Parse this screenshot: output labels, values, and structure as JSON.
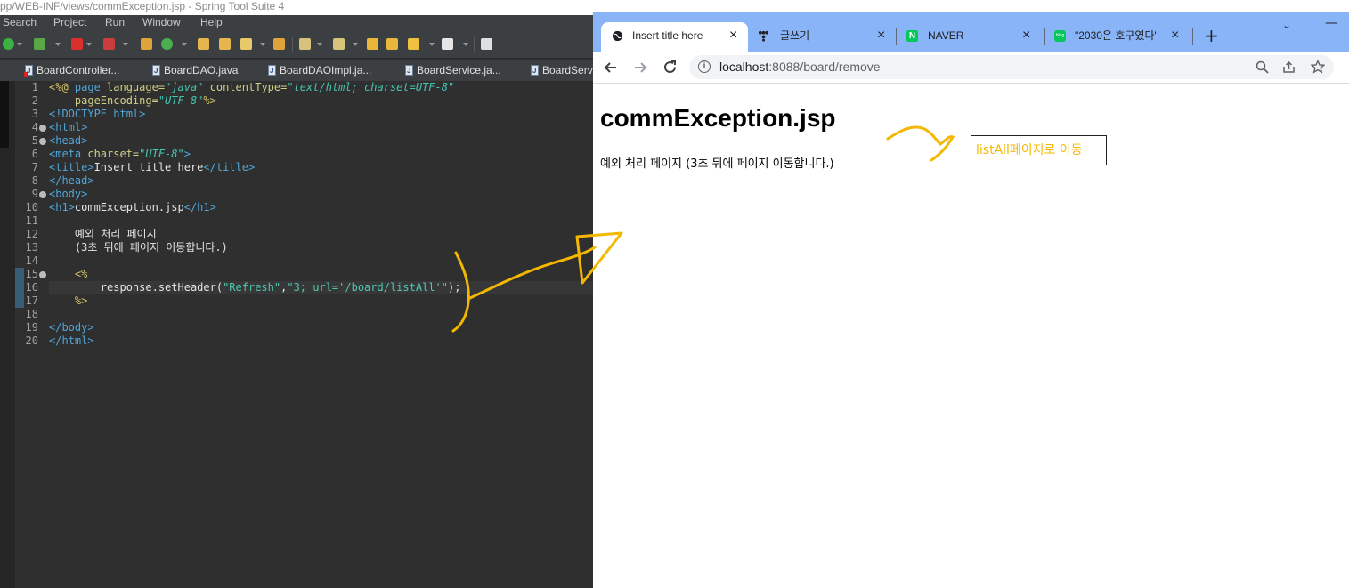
{
  "ide": {
    "title": "pp/WEB-INF/views/commException.jsp - Spring Tool Suite 4",
    "menu": [
      "Search",
      "Project",
      "Run",
      "Window",
      "Help"
    ],
    "tabs": [
      "BoardController...",
      "BoardDAO.java",
      "BoardDAOImpl.ja...",
      "BoardService.ja...",
      "BoardServi"
    ],
    "line_numbers": [
      "1",
      "2",
      "3",
      "4",
      "5",
      "6",
      "7",
      "8",
      "9",
      "10",
      "11",
      "12",
      "13",
      "14",
      "15",
      "16",
      "17",
      "18",
      "19",
      "20"
    ],
    "code": {
      "l1a": "<%@ ",
      "l1b": "page ",
      "l1c": "language=",
      "l1d": "\"java\"",
      "l1e": " contentType=",
      "l1f": "\"text/html; charset=UTF-8\"",
      "l2a": "    pageEncoding=",
      "l2b": "\"UTF-8\"",
      "l2c": "%>",
      "l3": "<!DOCTYPE html>",
      "l4": "<html>",
      "l5": "<head>",
      "l6a": "<meta ",
      "l6b": "charset=",
      "l6c": "\"UTF-8\"",
      "l6d": ">",
      "l7a": "<title>",
      "l7b": "Insert title here",
      "l7c": "</title>",
      "l8": "</head>",
      "l9": "<body>",
      "l10a": "<h1>",
      "l10b": "commException.jsp",
      "l10c": "</h1>",
      "l12": "    예외 처리 페이지",
      "l13": "    (3초 뒤에 페이지 이동합니다.)",
      "l15": "    <%",
      "l16a": "        response.setHeader(",
      "l16b": "\"Refresh\"",
      "l16c": ",",
      "l16d": "\"3; url='/board/listAll'\"",
      "l16e": ");",
      "l17": "    %>",
      "l19": "</body>",
      "l20": "</html>"
    }
  },
  "browser": {
    "tabs": [
      {
        "label": "Insert title here",
        "close": "×"
      },
      {
        "label": "글쓰기",
        "close": "×"
      },
      {
        "label": "NAVER",
        "close": "×"
      },
      {
        "label": "\"2030은 호구였다\"",
        "close": "×"
      }
    ],
    "new_tab": "+",
    "chevron": "⌄",
    "minimize": "—",
    "url_host": "localhost",
    "url_path": ":8088/board/remove",
    "page": {
      "h1": "commException.jsp",
      "text": "예외 처리 페이지 (3초 뒤에 페이지 이동합니다.)"
    }
  },
  "annotation": {
    "text": "listAll페이지로 이동",
    "color": "#f5b800"
  }
}
